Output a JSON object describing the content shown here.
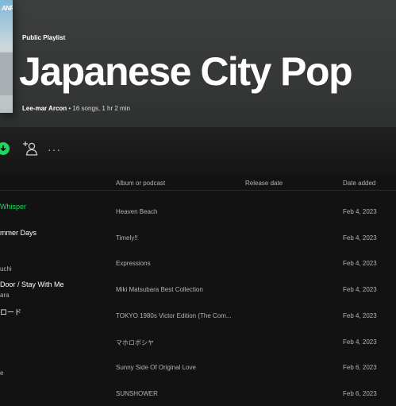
{
  "header": {
    "cover_text": "ANRI",
    "type_label": "Public Playlist",
    "title": "Japanese City Pop",
    "owner": "Lee-mar Arcon",
    "meta_rest": " • 16 songs, 1 hr 2 min"
  },
  "actions": {
    "download_icon": "download-icon",
    "add_user_icon": "add-user-icon",
    "more_label": "···"
  },
  "columns": {
    "album": "Album or podcast",
    "release": "Release date",
    "added": "Date added"
  },
  "tracks": [
    {
      "title": "Whisper",
      "artist": "",
      "album": "Heaven Beach",
      "added": "Feb 4, 2023",
      "active": true
    },
    {
      "title": "mmer Days",
      "artist": "",
      "album": "Timely!!",
      "added": "Feb 4, 2023"
    },
    {
      "title": "",
      "artist": "uchi",
      "album": "Expressions",
      "added": "Feb 4, 2023"
    },
    {
      "title": "Door / Stay With Me",
      "artist": "ara",
      "album": "Miki Matsubara Best Collection",
      "added": "Feb 4, 2023"
    },
    {
      "title": "ロード",
      "artist": "",
      "album": "TOKYO 1980s Victor Edition (The Com...",
      "added": "Feb 4, 2023"
    },
    {
      "title": "",
      "artist": "",
      "album": "マホロボシヤ",
      "added": "Feb 4, 2023"
    },
    {
      "title": "",
      "artist": "e",
      "album": "Sunny Side Of Original Love",
      "added": "Feb 6, 2023"
    },
    {
      "title": "",
      "artist": "",
      "album": "SUNSHOWER",
      "added": "Feb 6, 2023"
    }
  ],
  "colors": {
    "accent": "#1ed760",
    "background": "#121212",
    "header": "#3d3f3f"
  }
}
